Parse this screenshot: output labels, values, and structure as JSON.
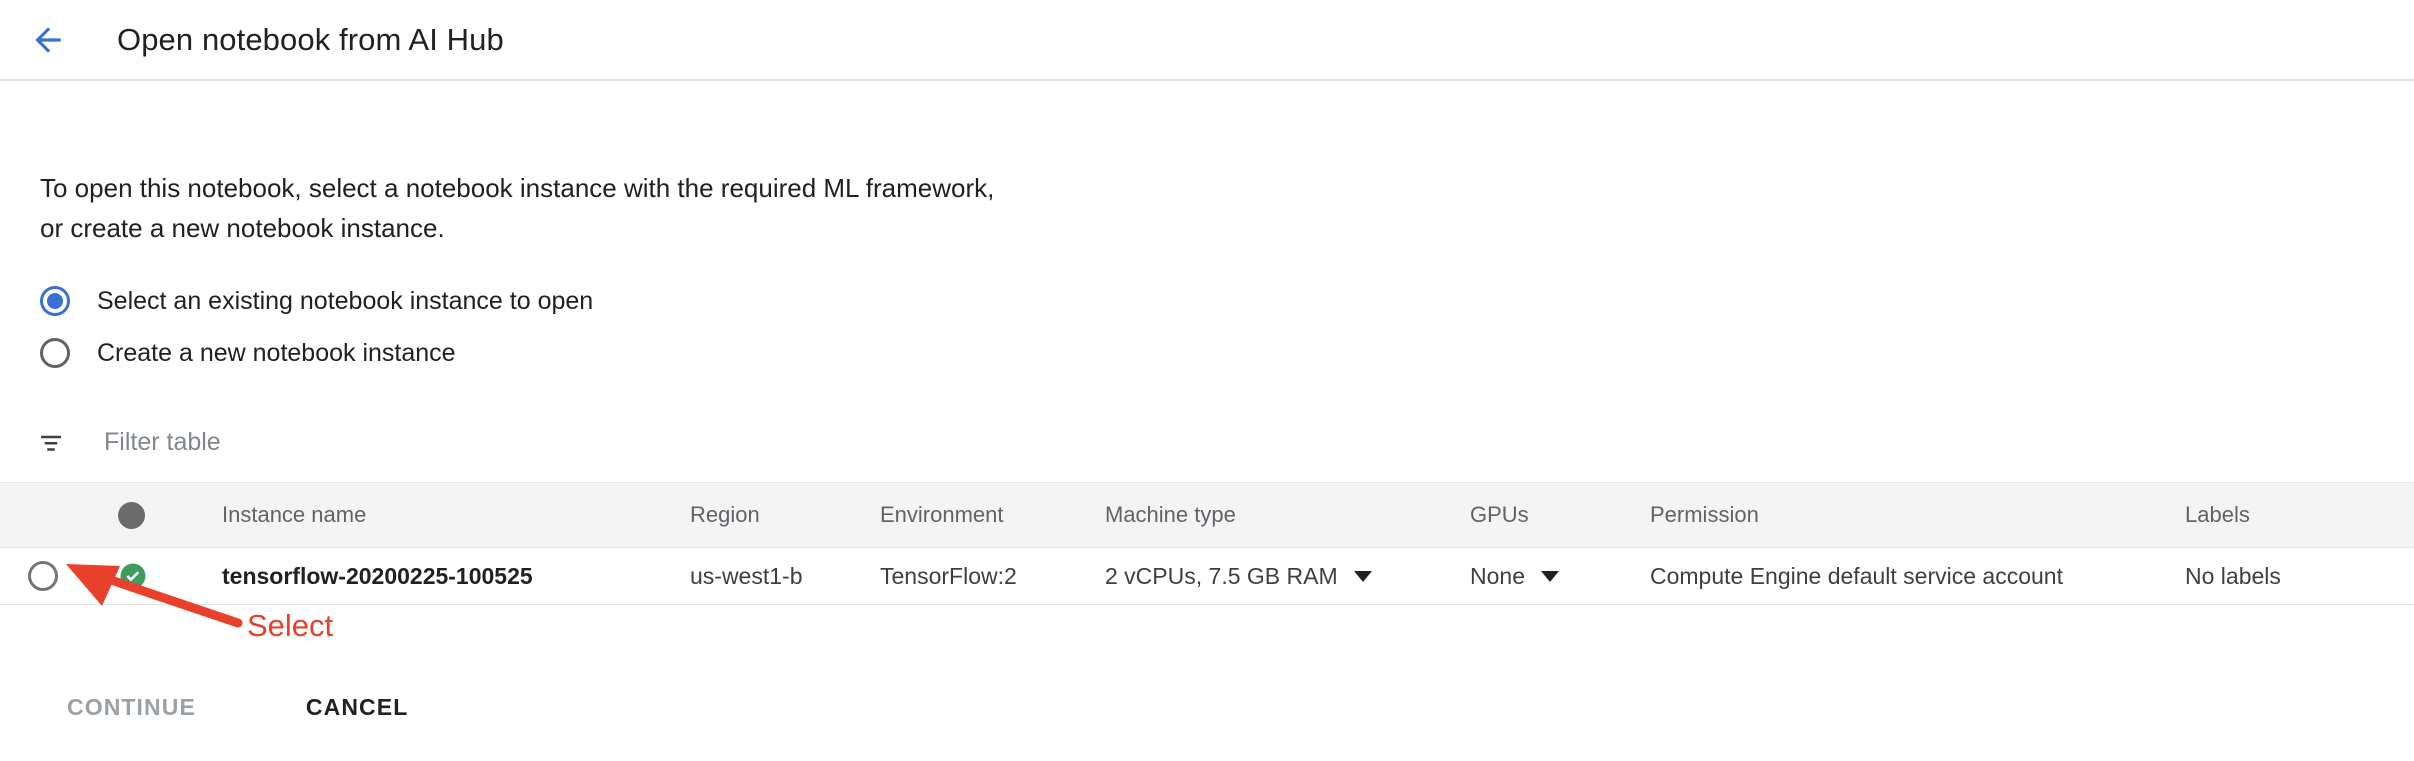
{
  "header": {
    "back_icon": "arrow-left-icon",
    "title": "Open notebook from AI Hub",
    "back_color": "#3b6fd4"
  },
  "description": "To open this notebook, select a notebook instance with the required ML framework, or create a new notebook instance.",
  "radio_options": [
    {
      "label": "Select an existing notebook instance to open",
      "selected": true
    },
    {
      "label": "Create a new notebook instance",
      "selected": false
    }
  ],
  "filter": {
    "icon": "filter-list-icon",
    "placeholder": "Filter table",
    "value": ""
  },
  "table": {
    "columns": [
      {
        "key": "select",
        "label": ""
      },
      {
        "key": "status",
        "label": ""
      },
      {
        "key": "name",
        "label": "Instance name"
      },
      {
        "key": "region",
        "label": "Region"
      },
      {
        "key": "environment",
        "label": "Environment"
      },
      {
        "key": "machine_type",
        "label": "Machine type"
      },
      {
        "key": "gpus",
        "label": "GPUs"
      },
      {
        "key": "permission",
        "label": "Permission"
      },
      {
        "key": "labels",
        "label": "Labels"
      }
    ],
    "header_status_icon": "filled-circle-icon",
    "rows": [
      {
        "selected": false,
        "status_icon": "check-circle-icon",
        "status_color": "#3f9c5f",
        "name": "tensorflow-20200225-100525",
        "region": "us-west1-b",
        "environment": "TensorFlow:2",
        "machine_type": "2 vCPUs, 7.5 GB RAM",
        "machine_type_has_caret": true,
        "gpus": "None",
        "gpus_has_caret": true,
        "permission": "Compute Engine default service account",
        "labels": "No labels"
      }
    ]
  },
  "footer": {
    "continue_label": "CONTINUE",
    "continue_disabled": true,
    "cancel_label": "CANCEL"
  },
  "annotation": {
    "label": "Select",
    "color": "#e8402a"
  }
}
